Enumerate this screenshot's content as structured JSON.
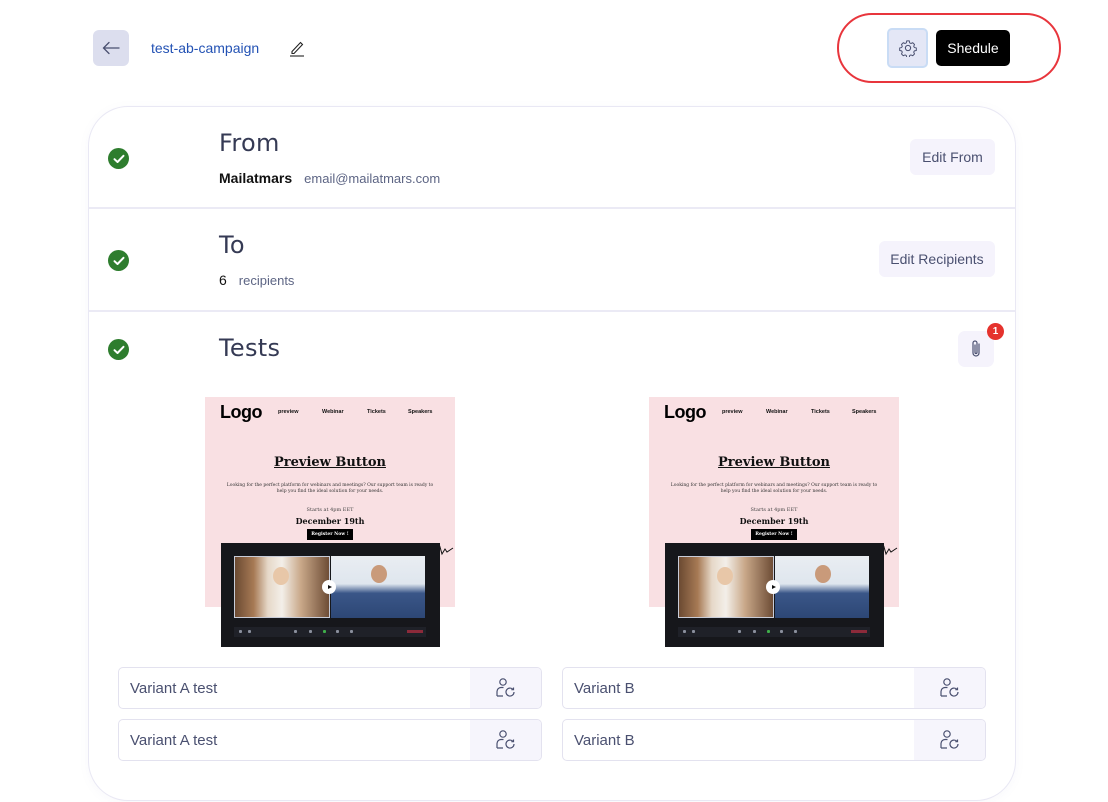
{
  "header": {
    "back_icon": "arrow-left-icon",
    "campaign_name": "test-ab-campaign",
    "edit_icon": "pencil-icon",
    "settings_icon": "gear-icon",
    "schedule_label": "Shedule"
  },
  "sections": {
    "from": {
      "status_icon": "check-circle-icon",
      "title": "From",
      "sender_name": "Mailatmars",
      "sender_email": "email@mailatmars.com",
      "edit_label": "Edit From"
    },
    "to": {
      "status_icon": "check-circle-icon",
      "title": "To",
      "recipient_count": "6",
      "recipient_label": "recipients",
      "edit_label": "Edit Recipients"
    },
    "tests": {
      "status_icon": "check-circle-icon",
      "title": "Tests",
      "attachment_icon": "paperclip-icon",
      "attachment_badge": "1",
      "previews": [
        {
          "logo": "Logo",
          "nav": [
            "preview",
            "Webinar",
            "Tickets",
            "Speakers"
          ],
          "title": "Preview Button",
          "description": "Looking for the perfect platform for webinars and meetings? Our support team is ready to help you find the ideal solution for your needs.",
          "starts": "Starts at 4pm EET",
          "date": "December 19th",
          "cta": "Register Now !"
        },
        {
          "logo": "Logo",
          "nav": [
            "preview",
            "Webinar",
            "Tickets",
            "Speakers"
          ],
          "title": "Preview Button",
          "description": "Looking for the perfect platform for webinars and meetings? Our support team is ready to help you find the ideal solution for your needs.",
          "starts": "Starts at 4pm EET",
          "date": "December 19th",
          "cta": "Register Now !"
        }
      ],
      "variants": {
        "a": [
          {
            "value": "Variant A test",
            "icon": "user-refresh-icon"
          },
          {
            "value": "Variant A test",
            "icon": "user-refresh-icon"
          }
        ],
        "b": [
          {
            "value": "Variant B",
            "icon": "user-refresh-icon"
          },
          {
            "value": "Variant B",
            "icon": "user-refresh-icon"
          }
        ]
      }
    }
  },
  "colors": {
    "accent_link": "#2352b4",
    "success": "#2e7d2e",
    "badge": "#e5322d",
    "highlight_ring": "#e8353c",
    "primary_button": "#000000"
  }
}
